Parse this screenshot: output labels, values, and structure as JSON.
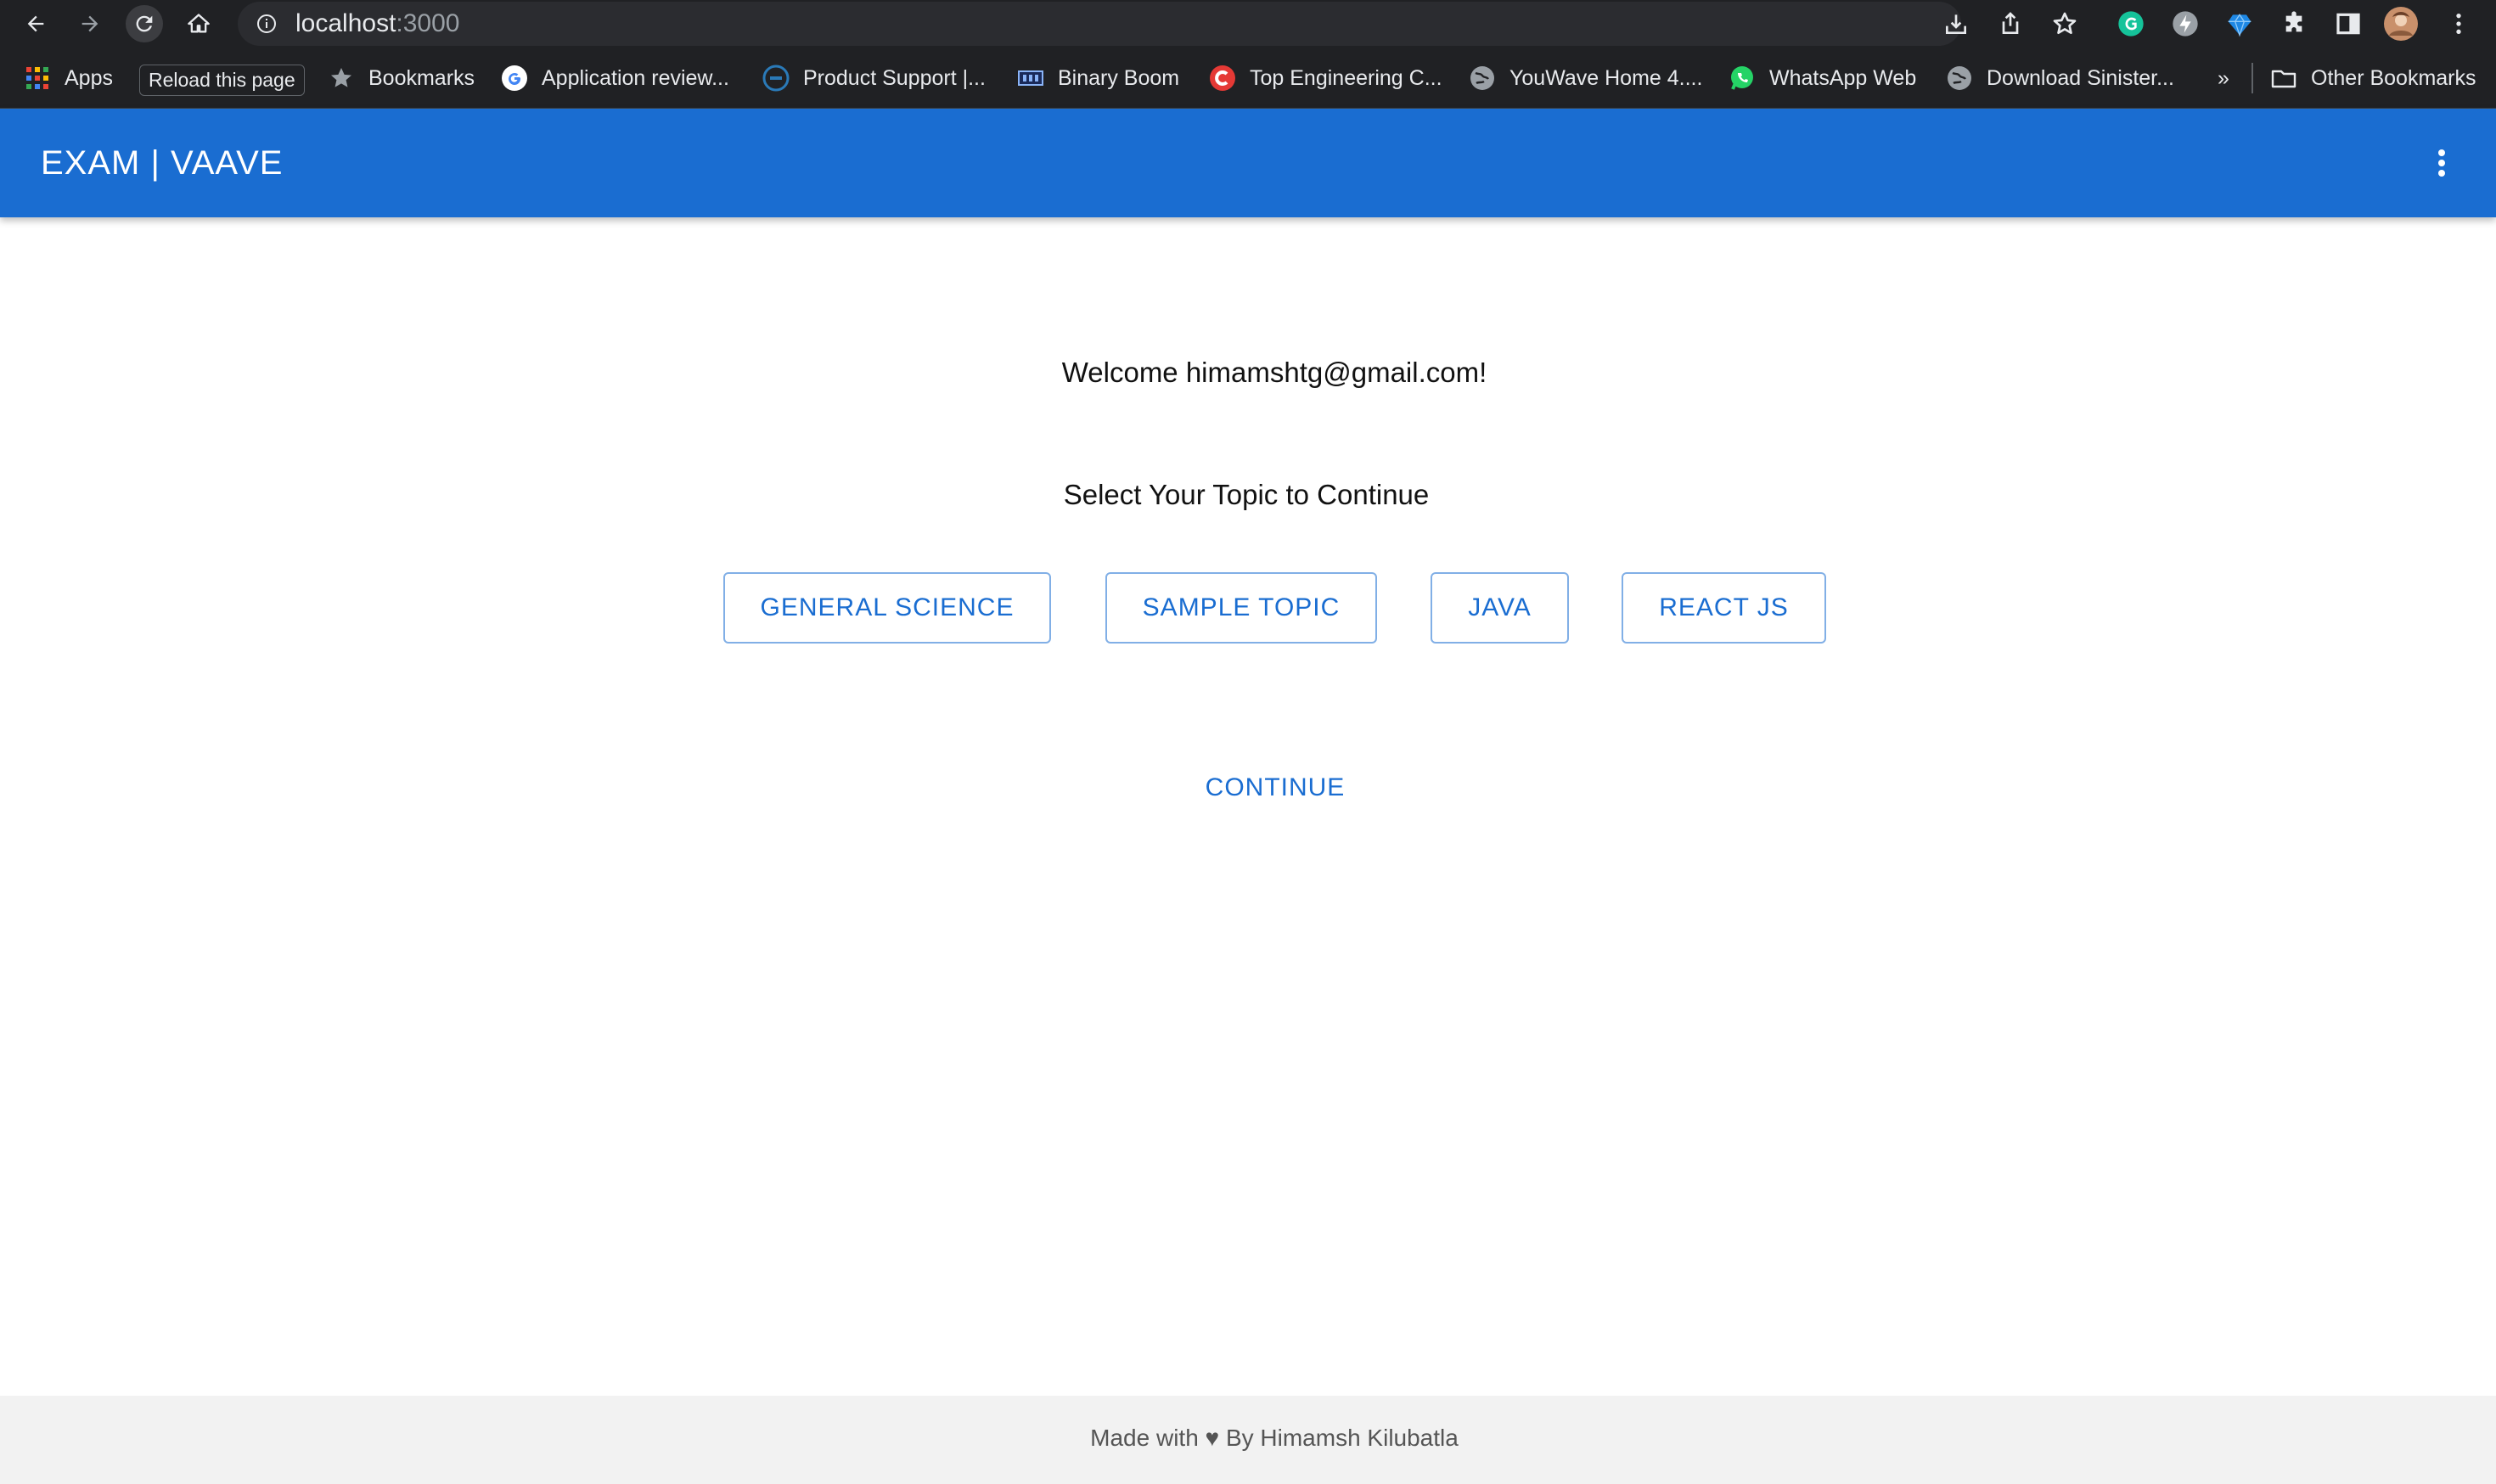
{
  "browser": {
    "url_host": "localhost",
    "url_port": ":3000",
    "tooltip": "Reload this page",
    "bookmarks": {
      "apps": "Apps",
      "bookmarks": "Bookmarks",
      "application_review": "Application review...",
      "product_support": "Product Support |...",
      "binary_boom": "Binary Boom",
      "top_engineering": "Top Engineering C...",
      "youwave": "YouWave Home 4....",
      "whatsapp": "WhatsApp Web",
      "download_sinister": "Download Sinister...",
      "overflow": "»",
      "other_bookmarks": "Other Bookmarks"
    },
    "icons": [
      "back-arrow-icon",
      "forward-arrow-icon",
      "reload-icon",
      "home-icon",
      "info-icon",
      "install-icon",
      "share-icon",
      "star-icon",
      "grammarly-icon",
      "bolt-extension-icon",
      "diamond-extension-icon",
      "puzzle-icon",
      "side-panel-icon",
      "avatar",
      "kebab-menu-icon"
    ]
  },
  "appbar": {
    "title": "EXAM | VAAVE",
    "menu_icon": "vertical-dots-icon",
    "color": "#1a6dd1"
  },
  "main": {
    "welcome": "Welcome himamshtg@gmail.com!",
    "prompt": "Select Your Topic to Continue",
    "topics": [
      "GENERAL SCIENCE",
      "SAMPLE TOPIC",
      "JAVA",
      "REACT JS"
    ],
    "continue_label": "CONTINUE"
  },
  "footer": {
    "text": "Made with ♥ By Himamsh Kilubatla"
  }
}
